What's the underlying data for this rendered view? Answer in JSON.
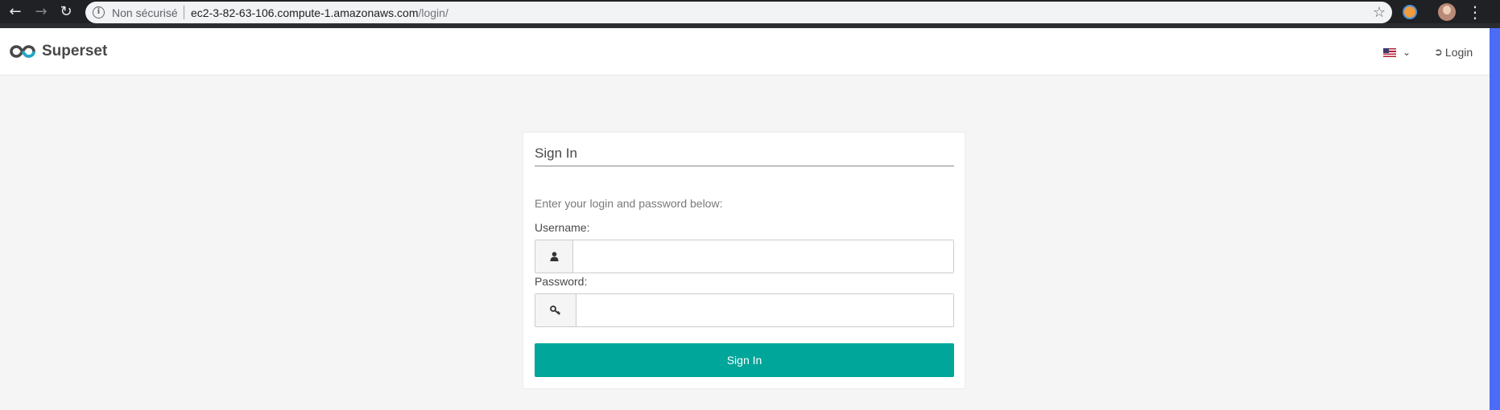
{
  "browser": {
    "security_label": "Non sécurisé",
    "url_host": "ec2-3-82-63-106.compute-1.amazonaws.com",
    "url_path": "/login/",
    "icons": [
      "back-icon",
      "forward-icon",
      "reload-icon",
      "info-icon",
      "star-icon",
      "extension-icon",
      "profile-avatar",
      "menu-icon"
    ]
  },
  "navbar": {
    "brand": "Superset",
    "login_label": "Login",
    "language_flag": "us-flag-icon"
  },
  "login_form": {
    "title": "Sign In",
    "hint": "Enter your login and password below:",
    "username_label": "Username:",
    "username_value": "",
    "password_label": "Password:",
    "password_value": "",
    "submit_label": "Sign In"
  },
  "colors": {
    "accent": "#00a699",
    "page_bg": "#f5f5f5",
    "brand_text": "#484848"
  }
}
